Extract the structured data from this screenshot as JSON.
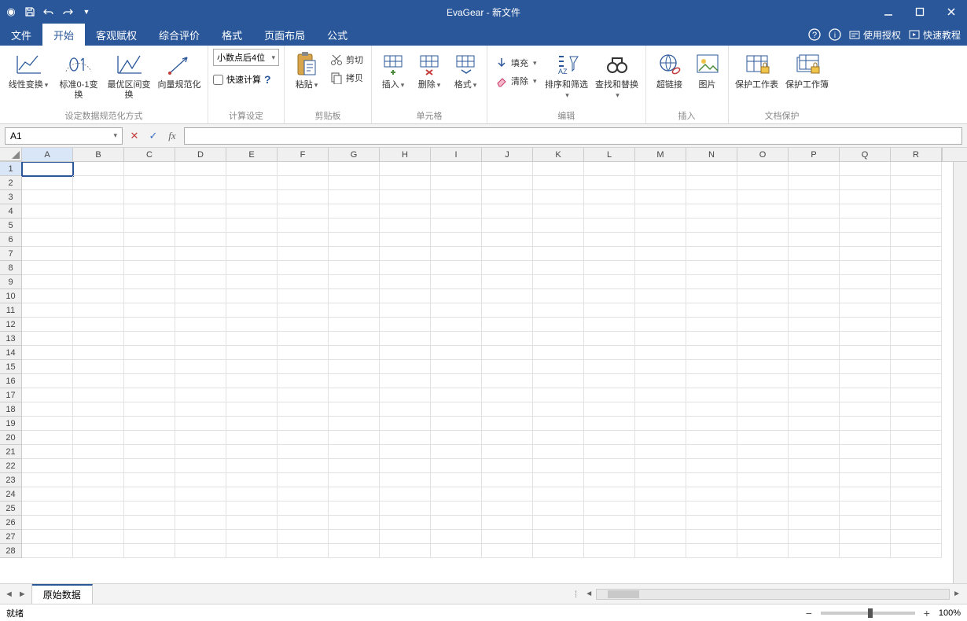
{
  "title": "EvaGear - 新文件",
  "menubar": {
    "tabs": [
      "文件",
      "开始",
      "客观赋权",
      "综合评价",
      "格式",
      "页面布局",
      "公式"
    ],
    "active_index": 1,
    "right": {
      "help": "?",
      "info": "i",
      "license": "使用授权",
      "tutorial": "快速教程"
    }
  },
  "ribbon": {
    "groups": {
      "normalize": {
        "label": "设定数据规范化方式",
        "linear": "线性变换",
        "standard01": "标准0-1变换",
        "optimal": "最优区间变换",
        "vector": "向量规范化"
      },
      "calc": {
        "label": "计算设定",
        "decimal_places": "小数点后4位",
        "fast_calc": "快速计算"
      },
      "clipboard": {
        "label": "剪贴板",
        "paste": "粘贴",
        "cut": "剪切",
        "copy": "拷贝"
      },
      "cells": {
        "label": "单元格",
        "insert": "插入",
        "delete": "删除",
        "format": "格式"
      },
      "edit": {
        "label": "编辑",
        "fill": "填充",
        "clear": "清除",
        "sort_filter": "排序和筛选",
        "find_replace": "查找和替换"
      },
      "insert": {
        "label": "插入",
        "hyperlink": "超链接",
        "picture": "图片"
      },
      "protect": {
        "label": "文档保护",
        "sheet": "保护工作表",
        "book": "保护工作簿"
      }
    }
  },
  "formula_bar": {
    "namebox": "A1",
    "fx_label": "fx",
    "formula": ""
  },
  "grid": {
    "columns": [
      "A",
      "B",
      "C",
      "D",
      "E",
      "F",
      "G",
      "H",
      "I",
      "J",
      "K",
      "L",
      "M",
      "N",
      "O",
      "P",
      "Q",
      "R"
    ],
    "rows": 28,
    "selected": {
      "row": 1,
      "col": "A"
    }
  },
  "sheets": {
    "active": "原始数据"
  },
  "statusbar": {
    "status": "就绪",
    "zoom": "100%"
  }
}
